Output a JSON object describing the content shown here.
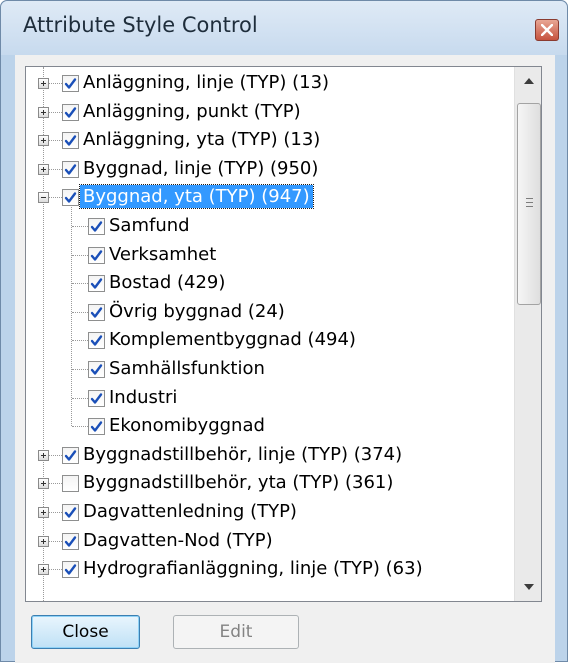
{
  "window": {
    "title": "Attribute Style Control"
  },
  "tree": {
    "items": [
      {
        "label": "Anläggning, linje (TYP) (13)",
        "level": 0,
        "expander": "plus",
        "checked": true,
        "selected": false
      },
      {
        "label": "Anläggning, punkt (TYP)",
        "level": 0,
        "expander": "plus",
        "checked": true,
        "selected": false
      },
      {
        "label": "Anläggning, yta (TYP) (13)",
        "level": 0,
        "expander": "plus",
        "checked": true,
        "selected": false
      },
      {
        "label": "Byggnad, linje (TYP) (950)",
        "level": 0,
        "expander": "plus",
        "checked": true,
        "selected": false
      },
      {
        "label": "Byggnad, yta (TYP) (947)",
        "level": 0,
        "expander": "minus",
        "checked": true,
        "selected": true
      },
      {
        "label": "Samfund",
        "level": 1,
        "expander": "none",
        "checked": true,
        "selected": false
      },
      {
        "label": "Verksamhet",
        "level": 1,
        "expander": "none",
        "checked": true,
        "selected": false
      },
      {
        "label": "Bostad (429)",
        "level": 1,
        "expander": "none",
        "checked": true,
        "selected": false
      },
      {
        "label": "Övrig byggnad (24)",
        "level": 1,
        "expander": "none",
        "checked": true,
        "selected": false
      },
      {
        "label": "Komplementbyggnad (494)",
        "level": 1,
        "expander": "none",
        "checked": true,
        "selected": false
      },
      {
        "label": "Samhällsfunktion",
        "level": 1,
        "expander": "none",
        "checked": true,
        "selected": false
      },
      {
        "label": "Industri",
        "level": 1,
        "expander": "none",
        "checked": true,
        "selected": false
      },
      {
        "label": "Ekonomibyggnad",
        "level": 1,
        "expander": "none",
        "checked": true,
        "selected": false
      },
      {
        "label": "Byggnadstillbehör, linje (TYP) (374)",
        "level": 0,
        "expander": "plus",
        "checked": true,
        "selected": false
      },
      {
        "label": "Byggnadstillbehör, yta (TYP) (361)",
        "level": 0,
        "expander": "plus",
        "checked": false,
        "selected": false
      },
      {
        "label": "Dagvattenledning (TYP)",
        "level": 0,
        "expander": "plus",
        "checked": true,
        "selected": false
      },
      {
        "label": "Dagvatten-Nod (TYP)",
        "level": 0,
        "expander": "plus",
        "checked": true,
        "selected": false
      },
      {
        "label": "Hydrografianläggning, linje (TYP) (63)",
        "level": 0,
        "expander": "plus",
        "checked": true,
        "selected": false
      }
    ]
  },
  "buttons": {
    "close_label": "Close",
    "edit_label": "Edit"
  },
  "icons": {
    "window_close": "close-x-icon",
    "scroll_up": "arrow-up-icon",
    "scroll_down": "arrow-down-icon",
    "checkmark": "checkmark-icon"
  },
  "colors": {
    "selection": "#3399ff",
    "checkmark": "#1a4fb8",
    "close_button_bg": "#c6533f"
  }
}
